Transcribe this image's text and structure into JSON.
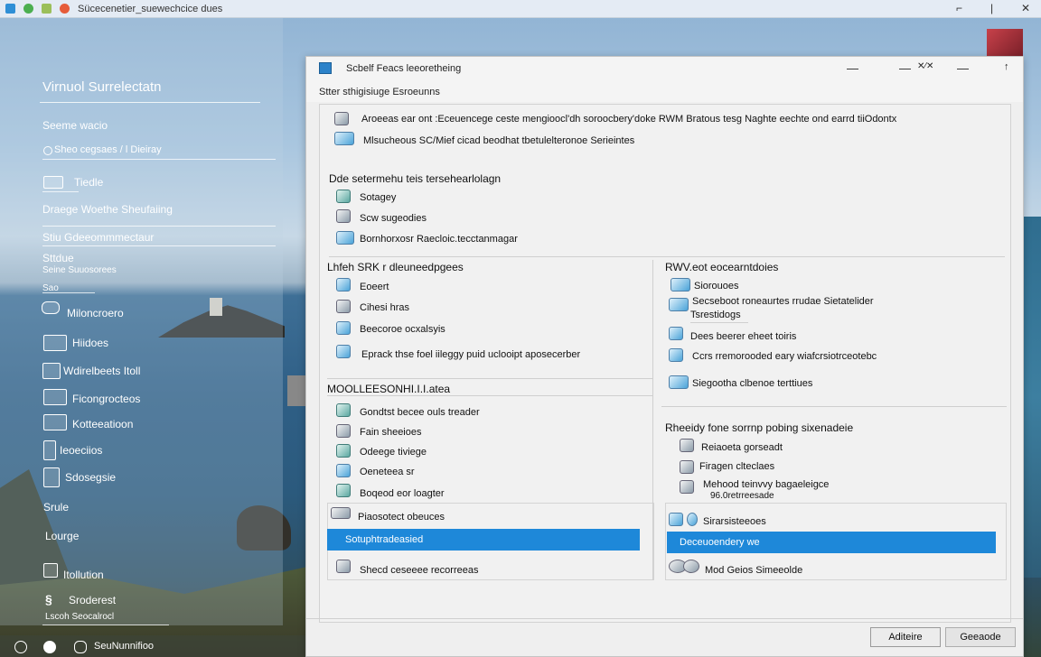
{
  "taskbar": {
    "title": "Sücecenetier_suewechcice dues",
    "controls": [
      "⌐",
      "|",
      "✕"
    ]
  },
  "left_panel": {
    "title": "Virnuol Surrelectatn",
    "items": [
      "Seeme wacio",
      "Sheo cegsaes / l Dieiray",
      "Tiedle",
      "Draege Woethe Sheufaiing",
      "Stiu Gdeeommmectaur",
      "Sttdue",
      "Seine Suuosorees",
      "Sao",
      "Miloncroero",
      "Hiidoes",
      "Wdirelbeets Itoll",
      "Ficongrocteos",
      "Kotteeatioon",
      "Ieoeciios",
      "Sdosegsie",
      "Srule",
      "Lourge",
      "Itollution",
      "Sroderest",
      "Lscoh Seocalrocl"
    ],
    "bottom_text": "SeuNunnifioo"
  },
  "window": {
    "title": "Scbelf Feacs leeoretheing",
    "subtitle": "Stter sthigisiuge Esroeunns",
    "controls": [
      "—",
      "—",
      "✕⁄✕",
      "—",
      "↑"
    ],
    "top_rows": [
      "Aroeeas ear ont :Eceuencege ceste mengioocl'dh soroocbery'doke RWM Bratous tesg Naghte eechte ond earrd tiiOdontx",
      "Mlsucheous SC/Mief cicad beodhat tbetulelteronoe Serieintes"
    ],
    "section1": {
      "header": "Dde setermehu teis tersehearlolagn",
      "items": [
        "Sotagey",
        "Scw sugeodies",
        "Bornhorxosr Raecloic.tecctanmagar"
      ]
    },
    "section2": {
      "header": "Lhfeh SRK r dleuneedpgees",
      "items": [
        "Eoeert",
        "Cihesi hras",
        "Beecoroe ocxalsyis",
        "Eprack thse foel iileggy puid uclooipt aposecerber"
      ]
    },
    "section3": {
      "header": "MOOLLEESONHI.I.I.atea",
      "items": [
        "Gondtst becee ouls treader",
        "Fain sheeioes",
        "Odeege tiviege",
        "Oeneteea sr",
        "Boqeod eor loagter"
      ],
      "extra_row": "Piaosotect obeuces",
      "selected": "Sotuphtradeasied",
      "last_row": "Shecd ceseeee recorreeas"
    },
    "section4": {
      "header": "RWV.eot eocearntdoies",
      "items": [
        "Siorouoes",
        "Secseboot roneaurtes rrudae Sietatelider",
        "Tsrestidogs",
        "Dees beerer eheet toiris",
        "Ccrs rremorooded eary wiafcrsiotrceotebc",
        "Siegootha clbenoe terttiues"
      ]
    },
    "section5": {
      "header": "Rheeidy fone sorrnp pobing sixenadeie",
      "items": [
        "Reiaoeta gorseadt",
        "Firagen clteclaes",
        "Mehood teinvvy bagaeleigce"
      ],
      "note": "96.0retrreesade",
      "extra_row": "Sirarsisteeoes",
      "selected": "Deceuoendery we",
      "last_row": "Mod Geios Simeeolde"
    },
    "buttons": {
      "primary": "Aditeire",
      "secondary": "Geeaode"
    }
  },
  "colors": {
    "selection": "#1e88d9",
    "window_bg": "#efefef",
    "accent_icon": "#2c82c9"
  }
}
